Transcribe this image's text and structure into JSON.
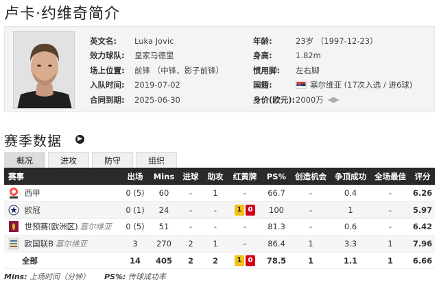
{
  "page": {
    "title": "卢卡·约维奇简介"
  },
  "profile": {
    "left": [
      {
        "label": "英文名:",
        "value": "Luka Jovic"
      },
      {
        "label": "效力球队:",
        "value": "皇家马德里"
      },
      {
        "label": "场上位置:",
        "value": "前锋 （中锋、影子前锋）"
      },
      {
        "label": "入队时间:",
        "value": "2019-07-02"
      },
      {
        "label": "合同到期:",
        "value": "2025-06-30"
      }
    ],
    "right": [
      {
        "label": "年龄:",
        "value": "23岁 （1997-12-23）"
      },
      {
        "label": "身高:",
        "value": "1.82m"
      },
      {
        "label": "惯用脚:",
        "value": "左右脚"
      },
      {
        "label": "国籍:",
        "value": "塞尔维亚 (17次入选 / 进6球)",
        "flag": "serbia"
      },
      {
        "label": "身价(欧元):",
        "value": "2000万",
        "icon": "value-arrows"
      }
    ]
  },
  "stats_section": {
    "title": "赛季数据",
    "tabs": [
      "概况",
      "进攻",
      "防守",
      "组织"
    ],
    "active_tab": 0,
    "headers": [
      "赛事",
      "出场",
      "Mins",
      "进球",
      "助攻",
      "红黄牌",
      "PS%",
      "创造机会",
      "争顶成功",
      "全场最佳",
      "评分"
    ],
    "rows": [
      {
        "logo": "laliga-logo",
        "name": "西甲",
        "sub": "",
        "apps": "0 (5)",
        "mins": "60",
        "goals": "-",
        "assists": "1",
        "yellow": "",
        "red": "",
        "cards_text": "-",
        "ps": "66.7",
        "chances": "-",
        "aerials": "0.4",
        "motm": "-",
        "rating": "6.26"
      },
      {
        "logo": "ucl-logo",
        "name": "欧冠",
        "sub": "",
        "apps": "0 (1)",
        "mins": "24",
        "goals": "-",
        "assists": "-",
        "yellow": "1",
        "red": "0",
        "cards_text": "",
        "ps": "100",
        "chances": "-",
        "aerials": "1",
        "motm": "-",
        "rating": "5.97"
      },
      {
        "logo": "wcq-logo",
        "name": "世预赛(欧洲区)",
        "sub": "塞尔维亚",
        "apps": "0 (5)",
        "mins": "51",
        "goals": "-",
        "assists": "-",
        "yellow": "",
        "red": "",
        "cards_text": "-",
        "ps": "81.3",
        "chances": "-",
        "aerials": "0.6",
        "motm": "-",
        "rating": "6.42"
      },
      {
        "logo": "unl-logo",
        "name": "欧国联B",
        "sub": "塞尔维亚",
        "apps": "3",
        "mins": "270",
        "goals": "2",
        "assists": "1",
        "yellow": "",
        "red": "",
        "cards_text": "-",
        "ps": "86.4",
        "chances": "1",
        "aerials": "3.3",
        "motm": "1",
        "rating": "7.96"
      }
    ],
    "total": {
      "name": "全部",
      "apps": "14",
      "mins": "405",
      "goals": "2",
      "assists": "2",
      "yellow": "1",
      "red": "0",
      "ps": "78.5",
      "chances": "1",
      "aerials": "1.1",
      "motm": "1",
      "rating": "6.66"
    }
  },
  "footnote": {
    "mins_key": "Mins:",
    "mins_desc": "上场时间（分钟）",
    "ps_key": "PS%:",
    "ps_desc": "传球成功率"
  },
  "colors": {
    "rating": "#e86a0a",
    "header_bg": "#2a2a2a",
    "yellow_card": "#f3c317",
    "red_card": "#d0021b"
  }
}
